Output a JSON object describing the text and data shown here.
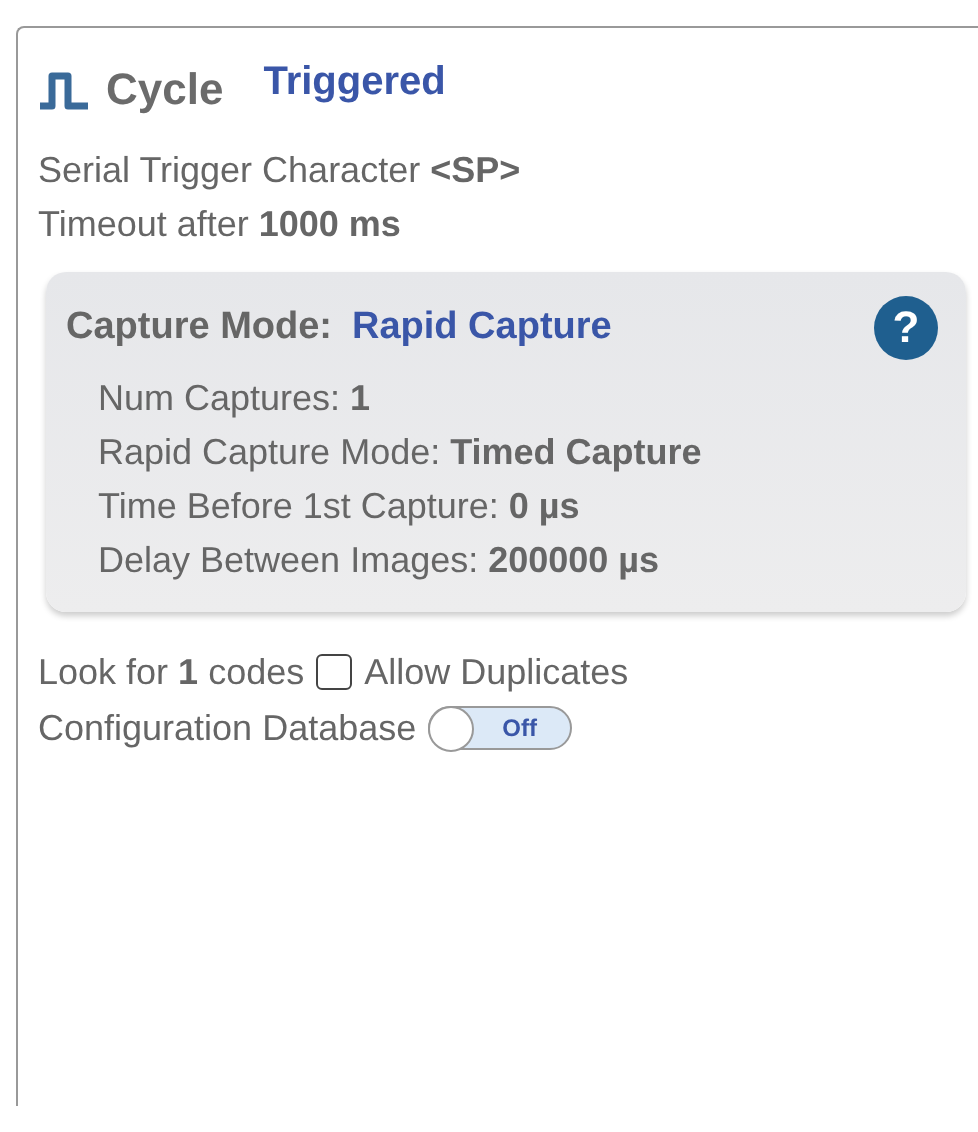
{
  "panel": {
    "title": "Cycle",
    "mode": "Triggered",
    "settings": [
      "Serial Trigger Character **<SP>**",
      "Timeout after **1000 ms**"
    ],
    "capture": {
      "label": "Capture Mode:",
      "value": "Rapid Capture",
      "help": "?",
      "details": [
        "Num Captures: **1**",
        "Rapid Capture Mode: **Timed Capture**",
        "Time Before 1st Capture: **0 µs**",
        "Delay Between Images: **200000 µs**"
      ]
    },
    "look_for": "Look for **1** codes",
    "allow_duplicates": {
      "label": "Allow Duplicates",
      "checked": false
    },
    "config_db": {
      "label": "Configuration Database",
      "on": false,
      "state_text": "Off"
    }
  }
}
